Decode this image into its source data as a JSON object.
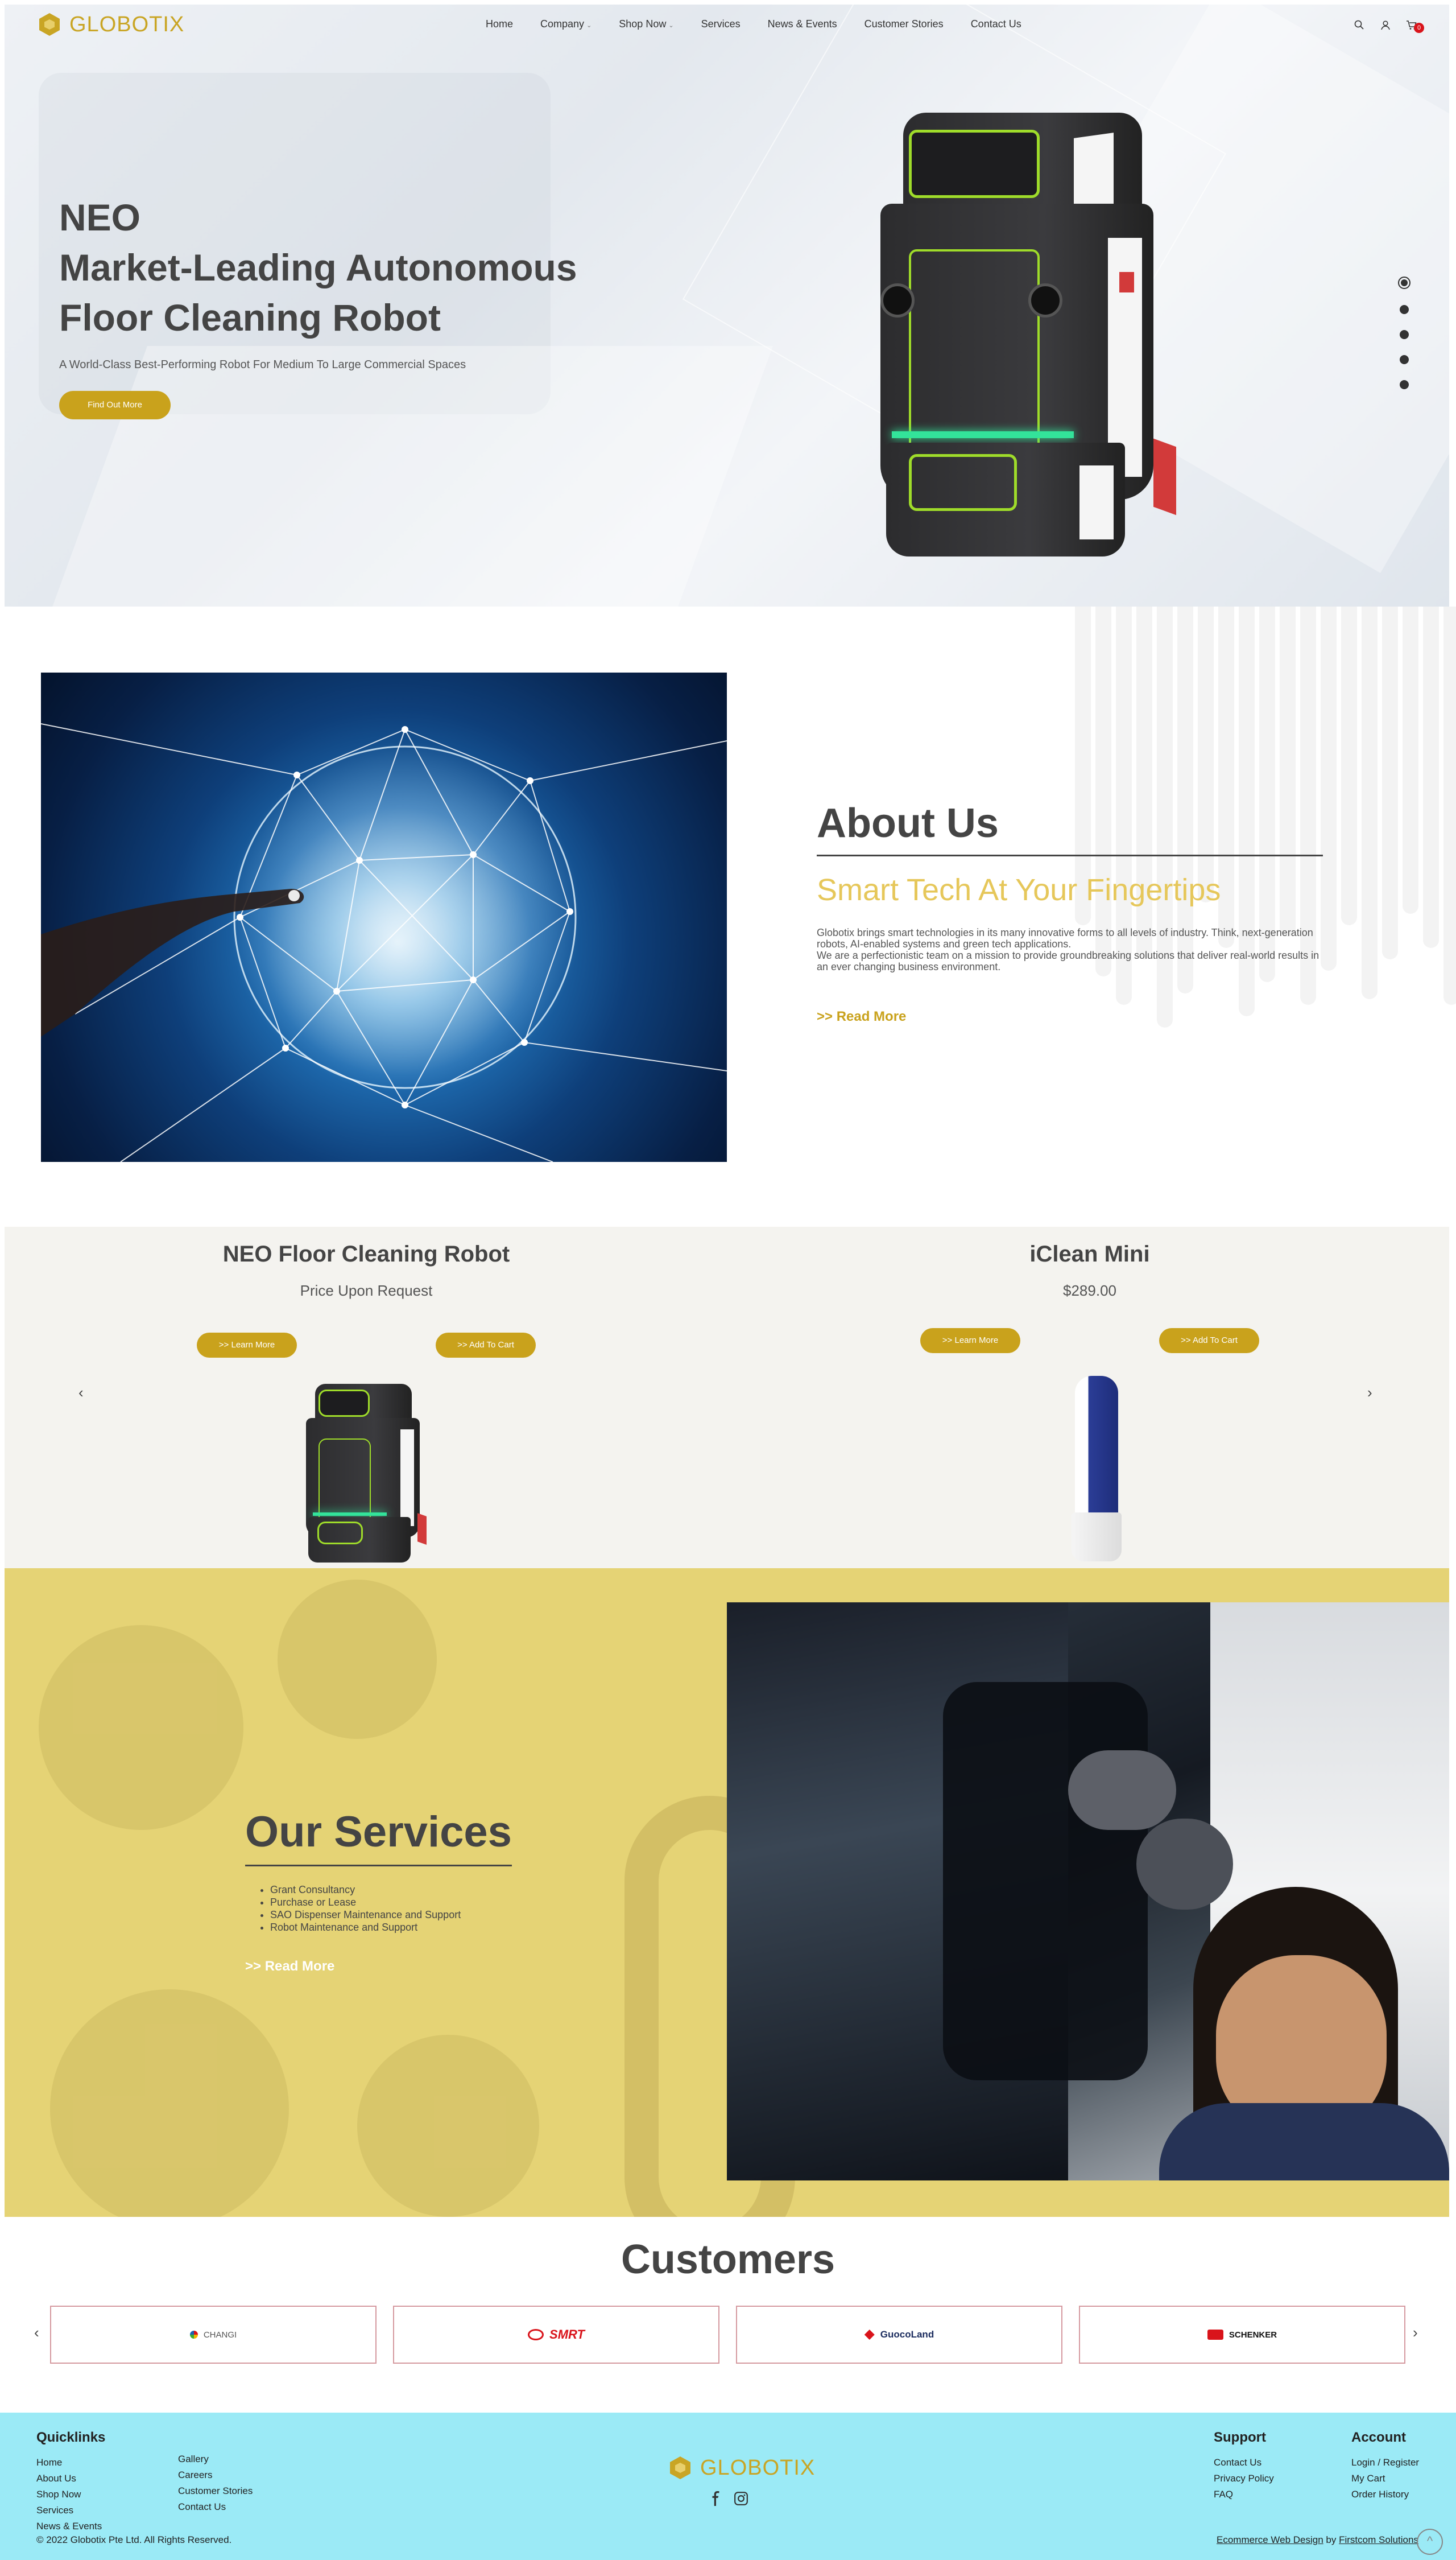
{
  "brand": {
    "name": "GLOBOTIX"
  },
  "nav": {
    "items": [
      {
        "label": "Home",
        "has_dropdown": false
      },
      {
        "label": "Company",
        "has_dropdown": true
      },
      {
        "label": "Shop Now",
        "has_dropdown": true
      },
      {
        "label": "Services",
        "has_dropdown": false
      },
      {
        "label": "News & Events",
        "has_dropdown": false
      },
      {
        "label": "Customer Stories",
        "has_dropdown": false
      },
      {
        "label": "Contact Us",
        "has_dropdown": false
      }
    ],
    "icons": [
      "search-icon",
      "user-icon",
      "cart-icon"
    ],
    "cart_count": "0"
  },
  "hero": {
    "title_line1": "NEO",
    "title_line2": "Market-Leading Autonomous",
    "title_line3": "Floor Cleaning Robot",
    "subtitle": "A World-Class Best-Performing Robot For Medium To Large Commercial Spaces",
    "cta": "Find Out More",
    "slide_count": 5,
    "active_slide": 1
  },
  "about": {
    "heading": "About Us",
    "tagline": "Smart Tech At Your Fingertips",
    "para1": "Globotix brings smart technologies in its many innovative forms to all levels of industry. Think, next-generation robots, AI-enabled systems and green tech applications.",
    "para2": "We are a perfectionistic team on a mission to provide groundbreaking solutions that deliver real-world results in an ever changing business environment.",
    "read_more": ">> Read More"
  },
  "products": {
    "items": [
      {
        "name": "NEO Floor Cleaning Robot",
        "price": "Price Upon Request",
        "learn_more": ">> Learn More",
        "add_to_cart": ">> Add To Cart"
      },
      {
        "name": "iClean Mini",
        "price": "$289.00",
        "learn_more": ">> Learn More",
        "add_to_cart": ">> Add To Cart"
      }
    ],
    "prev": "‹",
    "next": "›"
  },
  "services": {
    "heading": "Our Services",
    "list": [
      "Grant Consultancy",
      "Purchase or Lease",
      "SAO Dispenser Maintenance and Support",
      "Robot Maintenance and Support"
    ],
    "read_more": ">> Read More"
  },
  "customers": {
    "heading": "Customers",
    "logos": [
      {
        "name": "CHANGI",
        "color": "#555555"
      },
      {
        "name": "SMRT",
        "color": "#d9141b"
      },
      {
        "name": "GuocoLand",
        "color": "#1b2c5e"
      },
      {
        "name": "SCHENKER",
        "color": "#111111"
      }
    ],
    "prev": "‹",
    "next": "›"
  },
  "footer": {
    "quicklinks_heading": "Quicklinks",
    "quicklinks_col1": [
      "Home",
      "About Us",
      "Shop Now",
      "Services",
      "News & Events"
    ],
    "quicklinks_col2": [
      "Gallery",
      "Careers",
      "Customer Stories",
      "Contact Us"
    ],
    "support_heading": "Support",
    "support_links": [
      "Contact Us",
      "Privacy Policy",
      "FAQ"
    ],
    "account_heading": "Account",
    "account_links": [
      "Login / Register",
      "My Cart",
      "Order History"
    ],
    "social": [
      "facebook-icon",
      "instagram-icon"
    ],
    "copyright": "© 2022 Globotix Pte Ltd. All Rights Reserved.",
    "credit_link1": "Ecommerce Web Design",
    "credit_by": " by ",
    "credit_link2": "Firstcom Solutions",
    "back_to_top": "^"
  },
  "colors": {
    "gold": "#c9a21c",
    "tagline_gold": "#e6c75a",
    "services_bg": "#e5d375",
    "products_bg": "#f4f3ef",
    "footer_bg": "#9beaf6",
    "badge_red": "#d9141b"
  }
}
